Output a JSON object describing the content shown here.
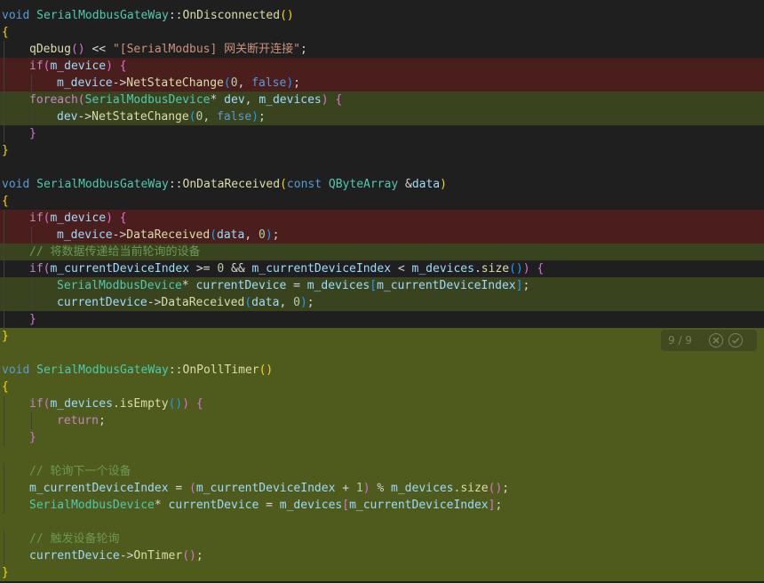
{
  "colors": {
    "removed_bg": "#4b1e1e",
    "added_bg": "#39441f",
    "added_bg_strong": "#4f5a1d",
    "editor_bg": "#1f1f1f"
  },
  "find_widget": {
    "count": "9 / 9",
    "icons": [
      "close-circle-icon",
      "check-circle-icon"
    ]
  },
  "lines": [
    {
      "bg": "",
      "indent": 0,
      "tokens": [
        [
          "kw",
          "void"
        ],
        [
          "plain",
          " "
        ],
        [
          "typ",
          "SerialModbusGateWay"
        ],
        [
          "op",
          "::"
        ],
        [
          "fn",
          "OnDisconnected"
        ],
        [
          "p1",
          "()"
        ]
      ]
    },
    {
      "bg": "",
      "indent": 0,
      "tokens": [
        [
          "p1",
          "{"
        ]
      ]
    },
    {
      "bg": "",
      "indent": 1,
      "tokens": [
        [
          "fn",
          "qDebug"
        ],
        [
          "p2",
          "()"
        ],
        [
          "plain",
          " << "
        ],
        [
          "str",
          "\"[SerialModbus] 网关断开连接\""
        ],
        [
          "plain",
          ";"
        ]
      ]
    },
    {
      "bg": "removed",
      "indent": 1,
      "tokens": [
        [
          "ctl",
          "if"
        ],
        [
          "p2",
          "("
        ],
        [
          "var",
          "m_device"
        ],
        [
          "p2",
          ")"
        ],
        [
          "plain",
          " "
        ],
        [
          "p2",
          "{"
        ]
      ]
    },
    {
      "bg": "removed",
      "indent": 2,
      "tokens": [
        [
          "var",
          "m_device"
        ],
        [
          "op",
          "->"
        ],
        [
          "fn",
          "NetStateChange"
        ],
        [
          "p3",
          "("
        ],
        [
          "num",
          "0"
        ],
        [
          "plain",
          ", "
        ],
        [
          "kw",
          "false"
        ],
        [
          "p3",
          ")"
        ],
        [
          "plain",
          ";"
        ]
      ]
    },
    {
      "bg": "added",
      "indent": 1,
      "tokens": [
        [
          "ctl",
          "foreach"
        ],
        [
          "p2",
          "("
        ],
        [
          "typ",
          "SerialModbusDevice"
        ],
        [
          "plain",
          "* "
        ],
        [
          "var",
          "dev"
        ],
        [
          "plain",
          ", "
        ],
        [
          "var",
          "m_devices"
        ],
        [
          "p2",
          ")"
        ],
        [
          "plain",
          " "
        ],
        [
          "p2",
          "{"
        ]
      ]
    },
    {
      "bg": "added",
      "indent": 2,
      "tokens": [
        [
          "var",
          "dev"
        ],
        [
          "op",
          "->"
        ],
        [
          "fn",
          "NetStateChange"
        ],
        [
          "p3",
          "("
        ],
        [
          "num",
          "0"
        ],
        [
          "plain",
          ", "
        ],
        [
          "kw",
          "false"
        ],
        [
          "p3",
          ")"
        ],
        [
          "plain",
          ";"
        ]
      ]
    },
    {
      "bg": "",
      "indent": 1,
      "tokens": [
        [
          "p2",
          "}"
        ]
      ]
    },
    {
      "bg": "",
      "indent": 0,
      "tokens": [
        [
          "p1",
          "}"
        ]
      ]
    },
    {
      "bg": "",
      "indent": 0,
      "tokens": []
    },
    {
      "bg": "",
      "indent": 0,
      "tokens": [
        [
          "kw",
          "void"
        ],
        [
          "plain",
          " "
        ],
        [
          "typ",
          "SerialModbusGateWay"
        ],
        [
          "op",
          "::"
        ],
        [
          "fn",
          "OnDataReceived"
        ],
        [
          "p1",
          "("
        ],
        [
          "kw",
          "const"
        ],
        [
          "plain",
          " "
        ],
        [
          "typ",
          "QByteArray"
        ],
        [
          "plain",
          " &"
        ],
        [
          "var",
          "data"
        ],
        [
          "p1",
          ")"
        ]
      ]
    },
    {
      "bg": "",
      "indent": 0,
      "tokens": [
        [
          "p1",
          "{"
        ]
      ]
    },
    {
      "bg": "removed",
      "indent": 1,
      "tokens": [
        [
          "ctl",
          "if"
        ],
        [
          "p2",
          "("
        ],
        [
          "var",
          "m_device"
        ],
        [
          "p2",
          ")"
        ],
        [
          "plain",
          " "
        ],
        [
          "p2",
          "{"
        ]
      ]
    },
    {
      "bg": "removed",
      "indent": 2,
      "tokens": [
        [
          "var",
          "m_device"
        ],
        [
          "op",
          "->"
        ],
        [
          "fn",
          "DataReceived"
        ],
        [
          "p3",
          "("
        ],
        [
          "var",
          "data"
        ],
        [
          "plain",
          ", "
        ],
        [
          "num",
          "0"
        ],
        [
          "p3",
          ")"
        ],
        [
          "plain",
          ";"
        ]
      ]
    },
    {
      "bg": "added",
      "indent": 1,
      "tokens": [
        [
          "com",
          "// 将数据传递给当前轮询的设备"
        ]
      ]
    },
    {
      "bg": "",
      "indent": 1,
      "tokens": [
        [
          "ctl",
          "if"
        ],
        [
          "p2",
          "("
        ],
        [
          "var",
          "m_currentDeviceIndex"
        ],
        [
          "plain",
          " >= "
        ],
        [
          "num",
          "0"
        ],
        [
          "plain",
          " && "
        ],
        [
          "var",
          "m_currentDeviceIndex"
        ],
        [
          "plain",
          " < "
        ],
        [
          "var",
          "m_devices"
        ],
        [
          "plain",
          "."
        ],
        [
          "fn",
          "size"
        ],
        [
          "p3",
          "()"
        ],
        [
          "p2",
          ")"
        ],
        [
          "plain",
          " "
        ],
        [
          "p2",
          "{"
        ]
      ]
    },
    {
      "bg": "added",
      "indent": 2,
      "tokens": [
        [
          "typ",
          "SerialModbusDevice"
        ],
        [
          "plain",
          "* "
        ],
        [
          "var",
          "currentDevice"
        ],
        [
          "plain",
          " = "
        ],
        [
          "var",
          "m_devices"
        ],
        [
          "p3",
          "["
        ],
        [
          "var",
          "m_currentDeviceIndex"
        ],
        [
          "p3",
          "]"
        ],
        [
          "plain",
          ";"
        ]
      ]
    },
    {
      "bg": "added",
      "indent": 2,
      "tokens": [
        [
          "var",
          "currentDevice"
        ],
        [
          "op",
          "->"
        ],
        [
          "fn",
          "DataReceived"
        ],
        [
          "p3",
          "("
        ],
        [
          "var",
          "data"
        ],
        [
          "plain",
          ", "
        ],
        [
          "num",
          "0"
        ],
        [
          "p3",
          ")"
        ],
        [
          "plain",
          ";"
        ]
      ]
    },
    {
      "bg": "",
      "indent": 1,
      "tokens": [
        [
          "p2",
          "}"
        ]
      ]
    },
    {
      "bg": "added2",
      "indent": 0,
      "tokens": [
        [
          "p1",
          "}"
        ]
      ]
    },
    {
      "bg": "added2",
      "indent": 0,
      "tokens": []
    },
    {
      "bg": "added2",
      "indent": 0,
      "tokens": [
        [
          "kw",
          "void"
        ],
        [
          "plain",
          " "
        ],
        [
          "typ",
          "SerialModbusGateWay"
        ],
        [
          "op",
          "::"
        ],
        [
          "fn",
          "OnPollTimer"
        ],
        [
          "p1",
          "()"
        ]
      ]
    },
    {
      "bg": "added2",
      "indent": 0,
      "tokens": [
        [
          "p1",
          "{"
        ]
      ]
    },
    {
      "bg": "added2",
      "indent": 1,
      "tokens": [
        [
          "ctl",
          "if"
        ],
        [
          "p2",
          "("
        ],
        [
          "var",
          "m_devices"
        ],
        [
          "plain",
          "."
        ],
        [
          "fn",
          "isEmpty"
        ],
        [
          "p3",
          "()"
        ],
        [
          "p2",
          ")"
        ],
        [
          "plain",
          " "
        ],
        [
          "p2",
          "{"
        ]
      ]
    },
    {
      "bg": "added2",
      "indent": 2,
      "tokens": [
        [
          "ctl",
          "return"
        ],
        [
          "plain",
          ";"
        ]
      ]
    },
    {
      "bg": "added2",
      "indent": 1,
      "tokens": [
        [
          "p2",
          "}"
        ]
      ]
    },
    {
      "bg": "added2",
      "indent": 0,
      "tokens": []
    },
    {
      "bg": "added2",
      "indent": 1,
      "tokens": [
        [
          "com",
          "// 轮询下一个设备"
        ]
      ]
    },
    {
      "bg": "added2",
      "indent": 1,
      "tokens": [
        [
          "var",
          "m_currentDeviceIndex"
        ],
        [
          "plain",
          " = "
        ],
        [
          "p2",
          "("
        ],
        [
          "var",
          "m_currentDeviceIndex"
        ],
        [
          "plain",
          " + "
        ],
        [
          "num",
          "1"
        ],
        [
          "p2",
          ")"
        ],
        [
          "plain",
          " % "
        ],
        [
          "var",
          "m_devices"
        ],
        [
          "plain",
          "."
        ],
        [
          "fn",
          "size"
        ],
        [
          "p2",
          "()"
        ],
        [
          "plain",
          ";"
        ]
      ]
    },
    {
      "bg": "added2",
      "indent": 1,
      "tokens": [
        [
          "typ",
          "SerialModbusDevice"
        ],
        [
          "plain",
          "* "
        ],
        [
          "var",
          "currentDevice"
        ],
        [
          "plain",
          " = "
        ],
        [
          "var",
          "m_devices"
        ],
        [
          "p2",
          "["
        ],
        [
          "var",
          "m_currentDeviceIndex"
        ],
        [
          "p2",
          "]"
        ],
        [
          "plain",
          ";"
        ]
      ]
    },
    {
      "bg": "added2",
      "indent": 0,
      "tokens": []
    },
    {
      "bg": "added2",
      "indent": 1,
      "tokens": [
        [
          "com",
          "// 触发设备轮询"
        ]
      ]
    },
    {
      "bg": "added2",
      "indent": 1,
      "tokens": [
        [
          "var",
          "currentDevice"
        ],
        [
          "op",
          "->"
        ],
        [
          "fn",
          "OnTimer"
        ],
        [
          "p2",
          "()"
        ],
        [
          "plain",
          ";"
        ]
      ]
    },
    {
      "bg": "added2",
      "indent": 0,
      "tokens": [
        [
          "p1",
          "}"
        ]
      ]
    }
  ]
}
